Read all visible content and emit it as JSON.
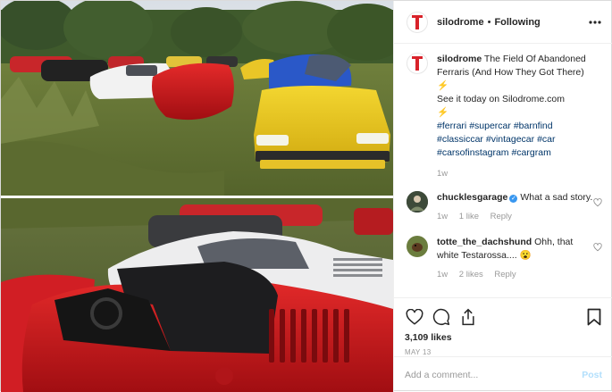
{
  "post": {
    "author": "silodrome",
    "separator": "•",
    "follow_status": "Following",
    "caption_text": "The Field Of Abandoned Ferraris (And How They Got There)",
    "caption_emoji_1": "⚡",
    "caption_line_2": "See it today on Silodrome.com",
    "caption_emoji_2": "⚡",
    "hashtags": [
      "#ferrari",
      "#supercar",
      "#barnfind",
      "#classiccar",
      "#vintagecar",
      "#car",
      "#carsofinstagram",
      "#cargram"
    ],
    "caption_time": "1w",
    "likes": "3,109 likes",
    "date": "MAY 13"
  },
  "comments": [
    {
      "username": "chucklesgarage",
      "verified_mark": "✓",
      "text": "What a sad story.",
      "time": "1w",
      "likes": "1 like",
      "reply": "Reply"
    },
    {
      "username": "totte_the_dachshund",
      "text": "Ohh, that white Testarossa....",
      "emoji": "😮",
      "time": "1w",
      "likes": "2 likes",
      "reply": "Reply"
    }
  ],
  "add_comment": {
    "placeholder": "Add a comment...",
    "post_label": "Post"
  },
  "icons": {
    "more": "more-options-icon",
    "like": "heart-icon",
    "comment": "comment-icon",
    "share": "share-icon",
    "save": "bookmark-icon"
  },
  "colors": {
    "brand_red": "#d8222a",
    "link_blue": "#003569",
    "post_button": "#b2dffc",
    "muted": "#999999"
  }
}
